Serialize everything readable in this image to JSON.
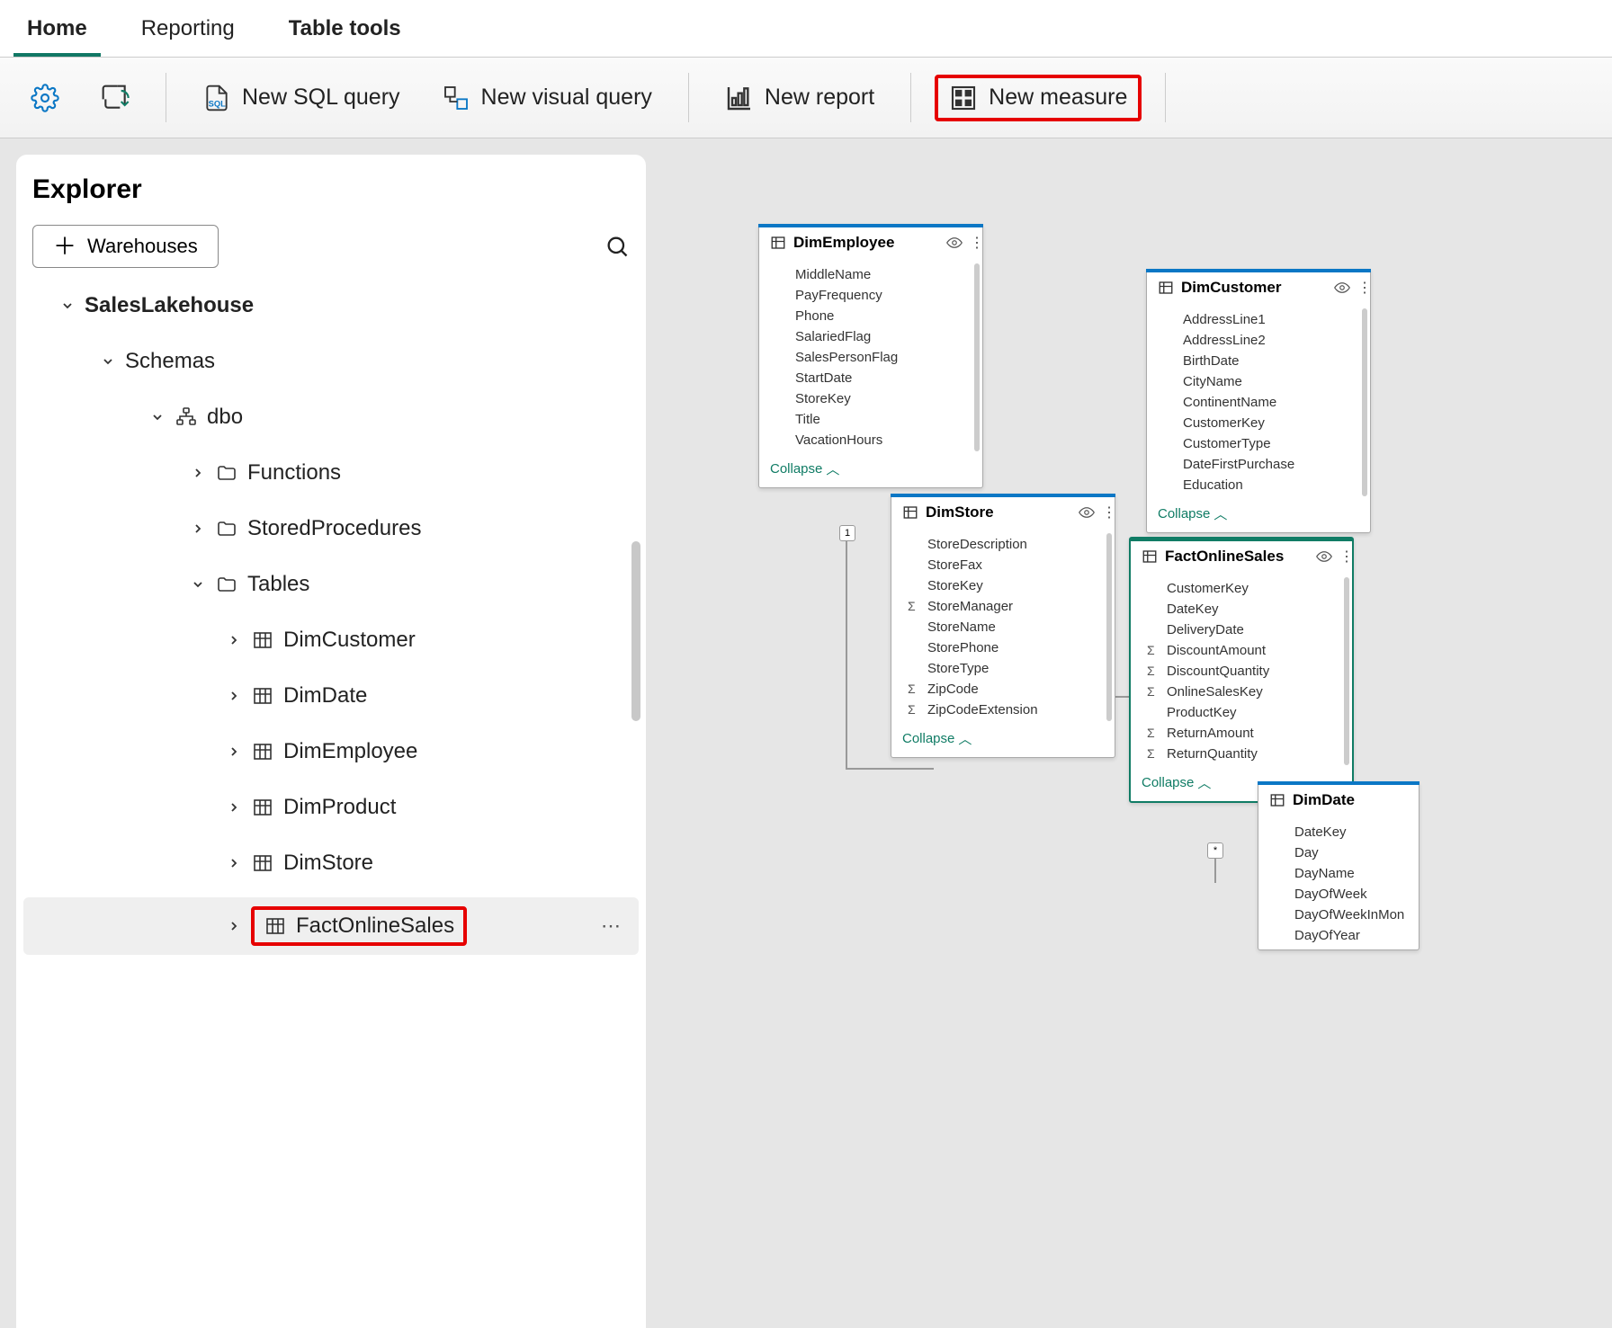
{
  "tabs": {
    "home": "Home",
    "reporting": "Reporting",
    "table_tools": "Table tools"
  },
  "toolbar": {
    "new_sql_query": "New SQL query",
    "new_visual_query": "New visual query",
    "new_report": "New report",
    "new_measure": "New measure"
  },
  "explorer": {
    "title": "Explorer",
    "warehouses_label": "Warehouses",
    "root": "SalesLakehouse",
    "schemas_label": "Schemas",
    "schema_name": "dbo",
    "folders": {
      "functions": "Functions",
      "stored_procedures": "StoredProcedures",
      "tables": "Tables"
    },
    "tables": [
      "DimCustomer",
      "DimDate",
      "DimEmployee",
      "DimProduct",
      "DimStore",
      "FactOnlineSales"
    ]
  },
  "cards": {
    "dim_employee": {
      "title": "DimEmployee",
      "collapse": "Collapse",
      "fields": [
        "MiddleName",
        "PayFrequency",
        "Phone",
        "SalariedFlag",
        "SalesPersonFlag",
        "StartDate",
        "StoreKey",
        "Title",
        "VacationHours"
      ]
    },
    "dim_customer": {
      "title": "DimCustomer",
      "collapse": "Collapse",
      "fields": [
        "AddressLine1",
        "AddressLine2",
        "BirthDate",
        "CityName",
        "ContinentName",
        "CustomerKey",
        "CustomerType",
        "DateFirstPurchase",
        "Education"
      ]
    },
    "dim_store": {
      "title": "DimStore",
      "collapse": "Collapse",
      "fields": [
        {
          "name": "StoreDescription",
          "sigma": false
        },
        {
          "name": "StoreFax",
          "sigma": false
        },
        {
          "name": "StoreKey",
          "sigma": false
        },
        {
          "name": "StoreManager",
          "sigma": true
        },
        {
          "name": "StoreName",
          "sigma": false
        },
        {
          "name": "StorePhone",
          "sigma": false
        },
        {
          "name": "StoreType",
          "sigma": false
        },
        {
          "name": "ZipCode",
          "sigma": true
        },
        {
          "name": "ZipCodeExtension",
          "sigma": true
        }
      ]
    },
    "fact_online_sales": {
      "title": "FactOnlineSales",
      "collapse": "Collapse",
      "fields": [
        {
          "name": "CustomerKey",
          "sigma": false
        },
        {
          "name": "DateKey",
          "sigma": false
        },
        {
          "name": "DeliveryDate",
          "sigma": false
        },
        {
          "name": "DiscountAmount",
          "sigma": true
        },
        {
          "name": "DiscountQuantity",
          "sigma": true
        },
        {
          "name": "OnlineSalesKey",
          "sigma": true
        },
        {
          "name": "ProductKey",
          "sigma": false
        },
        {
          "name": "ReturnAmount",
          "sigma": true
        },
        {
          "name": "ReturnQuantity",
          "sigma": true
        }
      ]
    },
    "dim_date": {
      "title": "DimDate",
      "fields": [
        "DateKey",
        "Day",
        "DayName",
        "DayOfWeek",
        "DayOfWeekInMon",
        "DayOfYear"
      ]
    }
  },
  "rel_labels": {
    "one": "1",
    "many": "*"
  }
}
